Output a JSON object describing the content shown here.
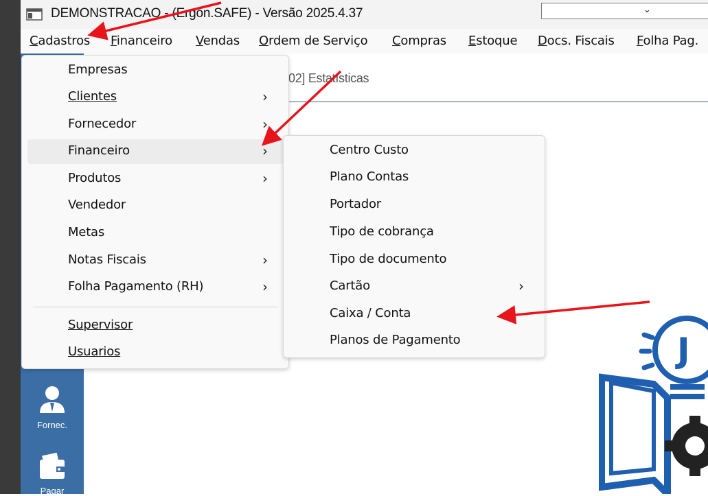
{
  "window": {
    "title": "DEMONSTRACAO - (Ergon.SAFE) - Versão 2025.4.37",
    "combo_arrow": "⌄"
  },
  "menubar": {
    "items": [
      {
        "label": "Cadastros"
      },
      {
        "label": "Financeiro"
      },
      {
        "label": "Vendas"
      },
      {
        "label": "Ordem de Serviço"
      },
      {
        "label": "Compras"
      },
      {
        "label": "Estoque"
      },
      {
        "label": "Docs. Fiscais"
      },
      {
        "label": "Folha Pag."
      }
    ]
  },
  "tab": {
    "label": "02] Estatísticas"
  },
  "side_panel": {
    "buttons": [
      {
        "label": "Fornec.",
        "icon": "person-icon"
      },
      {
        "label": "Pagar",
        "icon": "wallet-icon"
      }
    ]
  },
  "cadastros_menu": {
    "items": [
      {
        "label": "Empresas",
        "submenu": false
      },
      {
        "label": "Clientes",
        "submenu": true
      },
      {
        "label": "Fornecedor",
        "submenu": true
      },
      {
        "label": "Financeiro",
        "submenu": true
      },
      {
        "label": "Produtos",
        "submenu": true
      },
      {
        "label": "Vendedor",
        "submenu": false
      },
      {
        "label": "Metas",
        "submenu": false
      },
      {
        "label": "Notas Fiscais",
        "submenu": true
      },
      {
        "label": "Folha Pagamento (RH)",
        "submenu": true
      },
      {
        "label": "Supervisor",
        "submenu": false
      },
      {
        "label": "Usuarios",
        "submenu": false
      }
    ],
    "chevron": "›"
  },
  "financeiro_submenu": {
    "items": [
      {
        "label": "Centro Custo",
        "submenu": false
      },
      {
        "label": "Plano Contas",
        "submenu": false
      },
      {
        "label": "Portador",
        "submenu": false
      },
      {
        "label": "Tipo de cobrança",
        "submenu": false
      },
      {
        "label": "Tipo de documento",
        "submenu": false
      },
      {
        "label": "Cartão",
        "submenu": true
      },
      {
        "label": "Caixa / Conta",
        "submenu": false
      },
      {
        "label": "Planos de Pagamento",
        "submenu": false
      }
    ]
  },
  "logo": {
    "letter": "J"
  },
  "colors": {
    "accent": "#3a6ea5",
    "arrow": "#e8141b",
    "logo_blue": "#1f5fb0"
  }
}
